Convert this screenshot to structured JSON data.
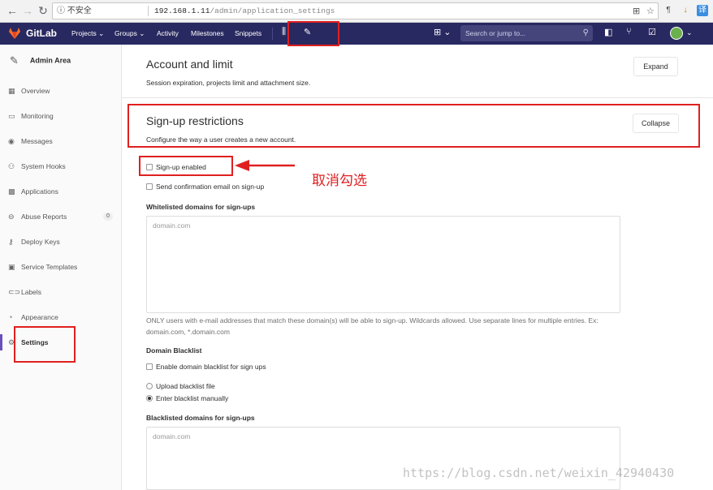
{
  "browser": {
    "security_label": "不安全",
    "url_host": "192.168.1.11",
    "url_path": "/admin/application_settings"
  },
  "navbar": {
    "brand": "GitLab",
    "items": [
      "Projects ⌄",
      "Groups ⌄",
      "Activity",
      "Milestones",
      "Snippets"
    ],
    "search_placeholder": "Search or jump to...",
    "colors": {
      "navbar_bg": "#292961",
      "accent": "#6b4fbb",
      "annotation": "#e02020"
    }
  },
  "sidebar": {
    "header": "Admin Area",
    "items": [
      {
        "label": "Overview",
        "icon": "overview-icon"
      },
      {
        "label": "Monitoring",
        "icon": "monitoring-icon"
      },
      {
        "label": "Messages",
        "icon": "messages-icon"
      },
      {
        "label": "System Hooks",
        "icon": "hooks-icon"
      },
      {
        "label": "Applications",
        "icon": "applications-icon"
      },
      {
        "label": "Abuse Reports",
        "icon": "abuse-icon",
        "badge": "0"
      },
      {
        "label": "Deploy Keys",
        "icon": "key-icon"
      },
      {
        "label": "Service Templates",
        "icon": "template-icon"
      },
      {
        "label": "Labels",
        "icon": "labels-icon"
      },
      {
        "label": "Appearance",
        "icon": "appearance-icon"
      },
      {
        "label": "Settings",
        "icon": "gear-icon",
        "active": true
      }
    ]
  },
  "main": {
    "account": {
      "title": "Account and limit",
      "desc": "Session expiration, projects limit and attachment size.",
      "button": "Expand"
    },
    "signup": {
      "title": "Sign-up restrictions",
      "desc": "Configure the way a user creates a new account.",
      "button": "Collapse",
      "signup_enabled": "Sign-up enabled",
      "send_confirmation": "Send confirmation email on sign-up",
      "whitelist_label": "Whitelisted domains for sign-ups",
      "whitelist_placeholder": "domain.com",
      "whitelist_help": "ONLY users with e-mail addresses that match these domain(s) will be able to sign-up. Wildcards allowed. Use separate lines for multiple entries. Ex: domain.com, *.domain.com",
      "blacklist_heading": "Domain Blacklist",
      "enable_blacklist": "Enable domain blacklist for sign ups",
      "upload_blacklist": "Upload blacklist file",
      "enter_blacklist": "Enter blacklist manually",
      "blacklisted_label": "Blacklisted domains for sign-ups",
      "blacklisted_placeholder": "domain.com"
    }
  },
  "annotation": {
    "text": "取消勾选"
  },
  "watermark": "https://blog.csdn.net/weixin_42940430"
}
